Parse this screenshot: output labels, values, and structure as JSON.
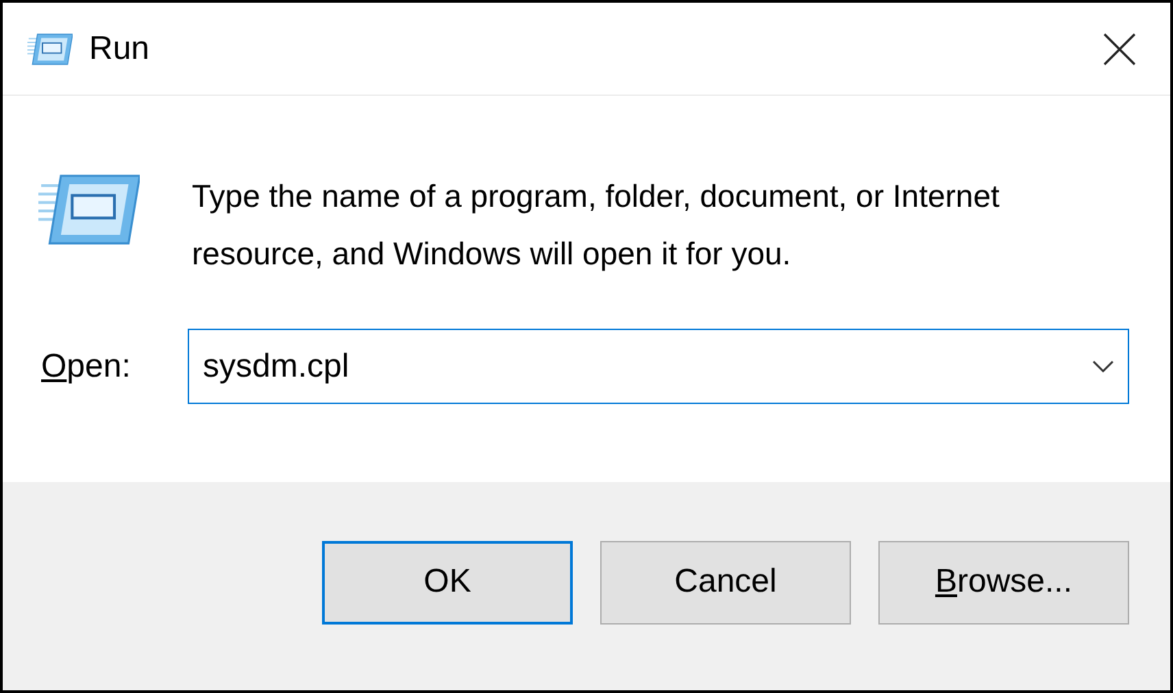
{
  "window": {
    "title": "Run"
  },
  "message": "Type the name of a program, folder, document, or Internet resource, and Windows will open it for you.",
  "open_field": {
    "label": {
      "mnemonic": "O",
      "rest": "pen:"
    },
    "value": "sysdm.cpl"
  },
  "buttons": [
    {
      "rest": "OK",
      "default": true
    },
    {
      "rest": "Cancel",
      "default": false
    },
    {
      "mnemonic": "B",
      "rest": "rowse...",
      "default": false
    }
  ]
}
